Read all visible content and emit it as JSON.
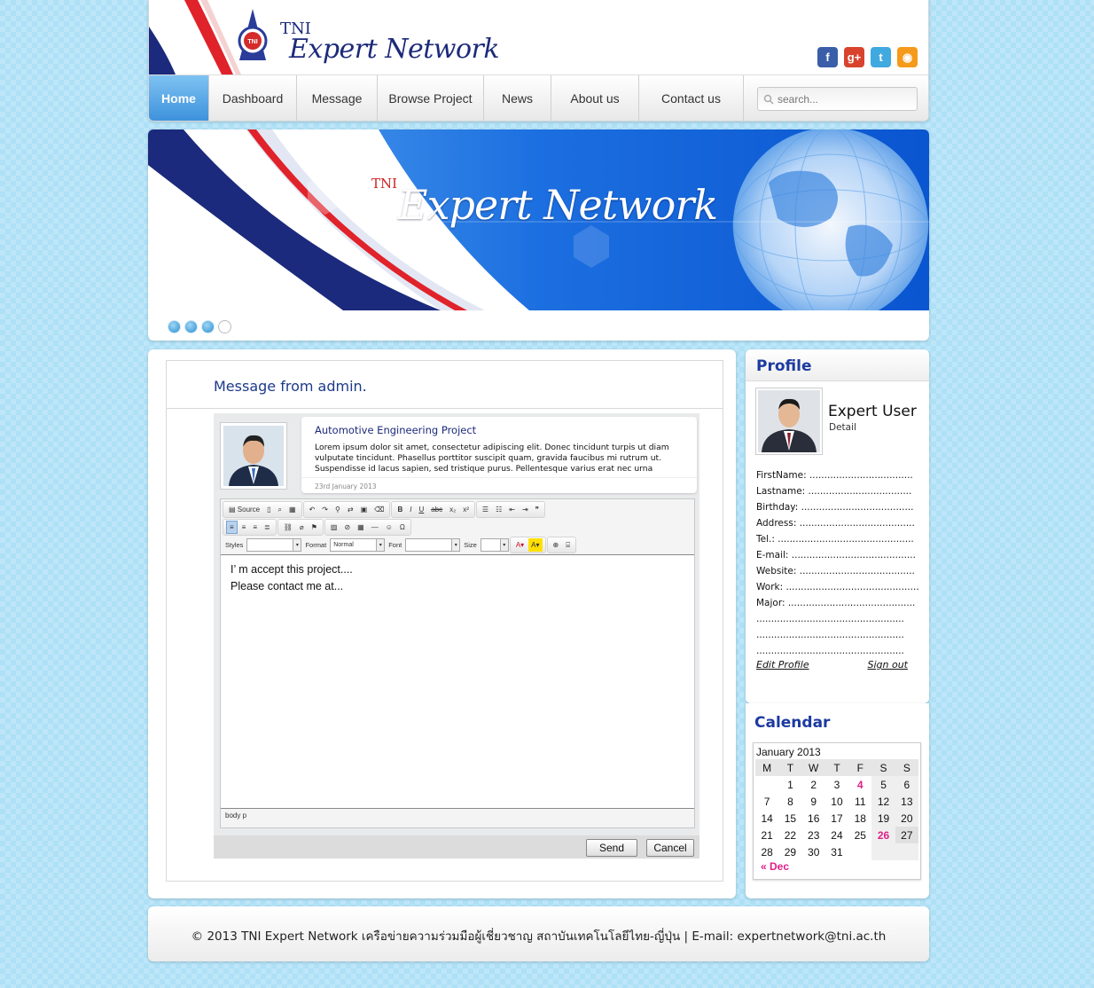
{
  "header": {
    "logo_small": "TNI",
    "logo_title": "Expert Network",
    "social": [
      {
        "icon": "facebook-icon",
        "glyph": "f",
        "color": "#3b5ea8"
      },
      {
        "icon": "google-plus-icon",
        "glyph": "g+",
        "color": "#d8432e"
      },
      {
        "icon": "twitter-icon",
        "glyph": "t",
        "color": "#3fa9e0"
      },
      {
        "icon": "rss-icon",
        "glyph": "◉",
        "color": "#f59a1a"
      }
    ]
  },
  "nav": {
    "items": [
      {
        "label": "Home",
        "active": true
      },
      {
        "label": "Dashboard"
      },
      {
        "label": "Message"
      },
      {
        "label": "Browse Project"
      },
      {
        "label": "News"
      },
      {
        "label": "About us"
      },
      {
        "label": "Contact us"
      }
    ],
    "search_placeholder": "search..."
  },
  "banner": {
    "small": "TNI",
    "title": "Expert Network",
    "slides": 4,
    "active_slide": 4
  },
  "message": {
    "heading": "Message from admin.",
    "project_title": "Automotive Engineering Project",
    "body": "Lorem ipsum dolor sit amet, consectetur adipiscing elit. Donec tincidunt turpis ut diam vulputate tincidunt. Phasellus porttitor suscipit quam, gravida faucibus mi rutrum ut. Suspendisse id lacus sapien, sed tristique purus. Pellentesque varius erat nec urna",
    "date": "23rd January 2013"
  },
  "editor": {
    "toolbar_source": "Source",
    "styles_label": "Styles",
    "format_label": "Format",
    "format_value": "Normal",
    "font_label": "Font",
    "size_label": "Size",
    "line1": "I’ m accept this project....",
    "line2": "Please contact me at...",
    "path": "body  p",
    "send_label": "Send",
    "cancel_label": "Cancel"
  },
  "profile": {
    "heading": "Profile",
    "name": "Expert User",
    "detail": "Detail",
    "fields": [
      "FirstName: ...................................",
      "Lastname: ...................................",
      "Birthday: ......................................",
      "Address: .......................................",
      "Tel.: ..............................................",
      "E-mail: ..........................................",
      "Website: .......................................",
      "Work: .............................................",
      "Major: ...........................................",
      "..................................................",
      "..................................................",
      ".................................................."
    ],
    "edit_label": "Edit Profile",
    "signout_label": "Sign out"
  },
  "calendar": {
    "heading": "Calendar",
    "month": "January 2013",
    "weekdays": [
      "M",
      "T",
      "W",
      "T",
      "F",
      "S",
      "S"
    ],
    "weeks": [
      [
        "",
        "1",
        "2",
        "3",
        "4",
        "5",
        "6"
      ],
      [
        "7",
        "8",
        "9",
        "10",
        "11",
        "12",
        "13"
      ],
      [
        "14",
        "15",
        "16",
        "17",
        "18",
        "19",
        "20"
      ],
      [
        "21",
        "22",
        "23",
        "24",
        "25",
        "26",
        "27"
      ],
      [
        "28",
        "29",
        "30",
        "31",
        "",
        "",
        ""
      ]
    ],
    "highlighted": [
      "4",
      "26"
    ],
    "today": "27",
    "prev_label": "« Dec"
  },
  "footer": {
    "text": "© 2013 TNI Expert Network   เครือข่ายความร่วมมือผู้เชี่ยวชาญ สถาบันเทคโนโลยีไทย-ญี่ปุ่น | E-mail: expertnetwork@tni.ac.th"
  }
}
